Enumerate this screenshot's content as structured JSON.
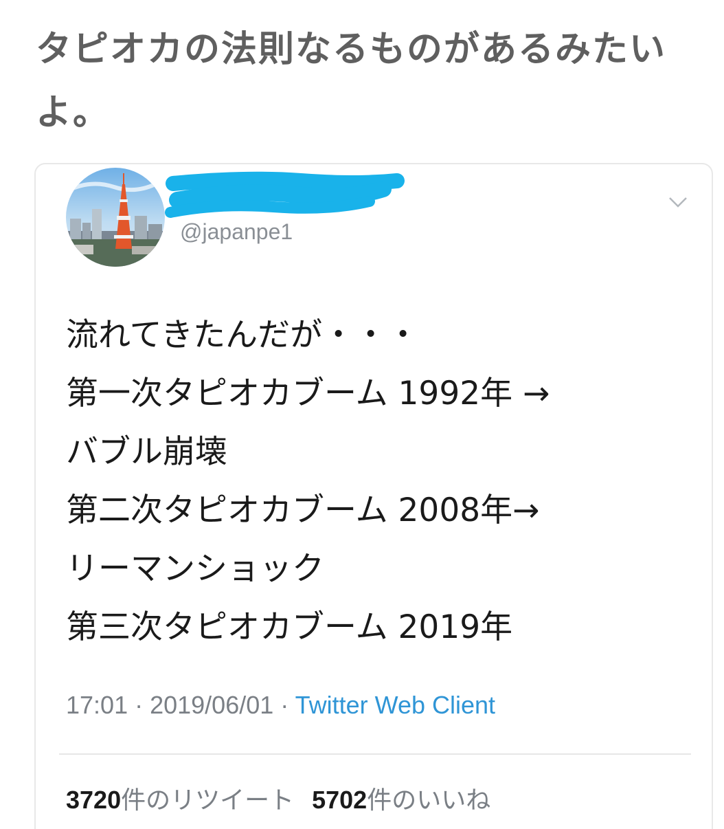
{
  "post": {
    "caption": "タピオカの法則なるものがあるみたいよ。"
  },
  "tweet": {
    "handle": "@japanpe1",
    "body_lines": [
      "流れてきたんだが・・・",
      "第一次タピオカブーム 1992年 →",
      "バブル崩壊",
      "第二次タピオカブーム 2008年→",
      "リーマンショック",
      "第三次タピオカブーム 2019年"
    ],
    "time": "17:01",
    "date": "2019/06/01",
    "separator": " · ",
    "client": "Twitter Web Client",
    "retweet_count": "3720",
    "retweet_label": "件のリツイート",
    "like_count": "5702",
    "like_label": "件のいいね"
  },
  "icons": {
    "avatar": "tokyo-tower-avatar",
    "caret": "chevron-down-icon",
    "redaction": "blue-scribble-redaction"
  },
  "colors": {
    "caption_text": "#5f5f5f",
    "body_text": "#1a1a1a",
    "secondary_text": "#7a7f85",
    "link": "#2f95d6",
    "redaction": "#19b2ea"
  }
}
